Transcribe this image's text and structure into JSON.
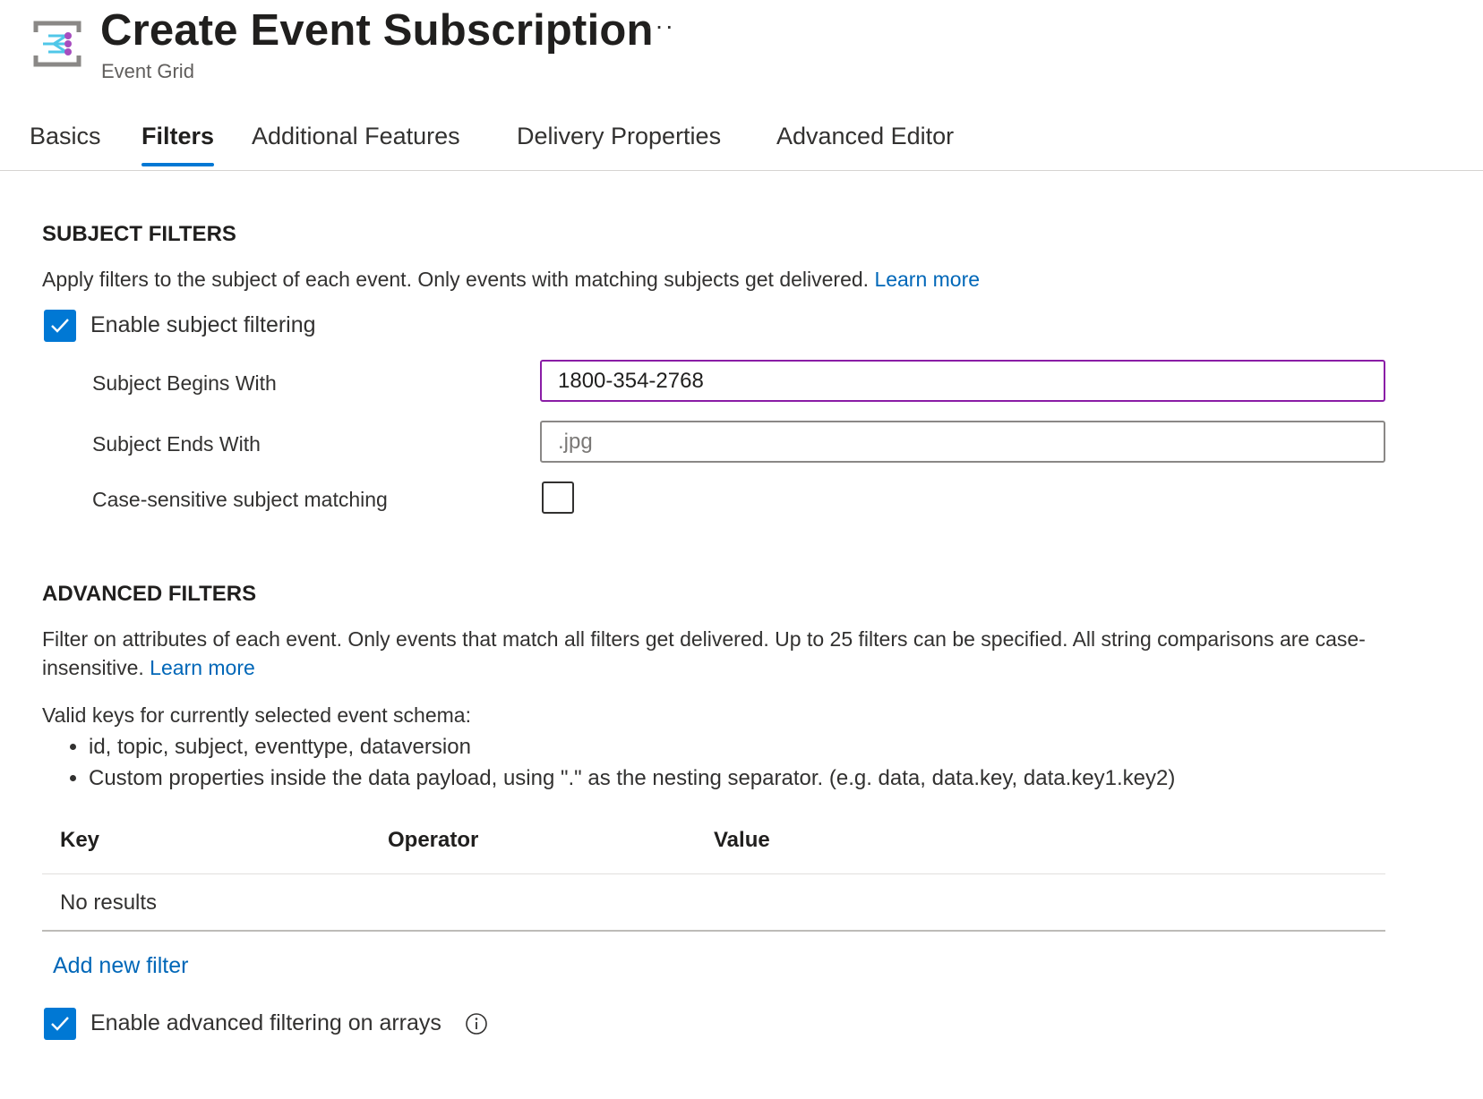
{
  "header": {
    "title": "Create Event Subscription",
    "subtitle": "Event Grid",
    "more": "···",
    "logo_icon": "event-grid-icon"
  },
  "tabs": [
    {
      "label": "Basics",
      "active": false
    },
    {
      "label": "Filters",
      "active": true
    },
    {
      "label": "Additional Features",
      "active": false
    },
    {
      "label": "Delivery Properties",
      "active": false
    },
    {
      "label": "Advanced Editor",
      "active": false
    }
  ],
  "subject_filters": {
    "heading": "SUBJECT FILTERS",
    "description": "Apply filters to the subject of each event. Only events with matching subjects get delivered.",
    "learn_more": "Learn more",
    "enable_label": "Enable subject filtering",
    "enable_checked": true,
    "begins_with_label": "Subject Begins With",
    "begins_with_value": "1800-354-2768",
    "ends_with_label": "Subject Ends With",
    "ends_with_placeholder": ".jpg",
    "case_sensitive_label": "Case-sensitive subject matching",
    "case_sensitive_checked": false
  },
  "advanced_filters": {
    "heading": "ADVANCED FILTERS",
    "description": "Filter on attributes of each event. Only events that match all filters get delivered. Up to 25 filters can be specified. All string comparisons are case-insensitive.",
    "learn_more": "Learn more",
    "valid_keys_intro": "Valid keys for currently selected event schema:",
    "valid_keys": [
      "id, topic, subject, eventtype, dataversion",
      "Custom properties inside the data payload, using \".\" as the nesting separator. (e.g. data, data.key, data.key1.key2)"
    ],
    "table": {
      "columns": [
        "Key",
        "Operator",
        "Value"
      ],
      "empty_text": "No results"
    },
    "add_filter": "Add new filter",
    "arrays_label": "Enable advanced filtering on arrays",
    "arrays_checked": true
  },
  "colors": {
    "accent": "#0078d4",
    "link": "#0067b8",
    "focus_border": "#8a1da6"
  }
}
